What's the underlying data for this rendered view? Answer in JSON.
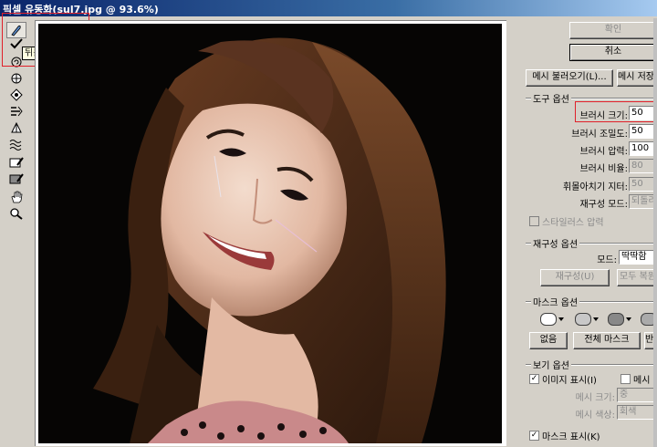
{
  "window": {
    "title": "픽셀 유동화(sul7.jpg @ 93.6%)"
  },
  "toolbox": {
    "tooltip": "뒤틀기 도구(W)",
    "tools": [
      {
        "name": "forward-warp-tool-icon"
      },
      {
        "name": "reconstruct-tool-icon"
      },
      {
        "name": "twirl-tool-icon"
      },
      {
        "name": "pucker-tool-icon"
      },
      {
        "name": "bloat-tool-icon"
      },
      {
        "name": "push-left-tool-icon"
      },
      {
        "name": "mirror-tool-icon"
      },
      {
        "name": "turbulence-tool-icon"
      },
      {
        "name": "freeze-mask-tool-icon"
      },
      {
        "name": "thaw-mask-tool-icon"
      },
      {
        "name": "hand-tool-icon"
      },
      {
        "name": "zoom-tool-icon"
      }
    ]
  },
  "panel": {
    "ok": "확인",
    "cancel": "취소",
    "load_mesh": "메시 불러오기(L)...",
    "save_mesh": "메시 저장",
    "tool_options": {
      "title": "도구 옵션",
      "brush_size": {
        "label": "브러시 크기:",
        "value": "50"
      },
      "brush_density": {
        "label": "브러시 조밀도:",
        "value": "50"
      },
      "brush_pressure": {
        "label": "브러시 압력:",
        "value": "100"
      },
      "brush_rate": {
        "label": "브러시 비율:",
        "value": "80"
      },
      "turbulent_jitter": {
        "label": "휘몰아치기 지터:",
        "value": "50"
      },
      "reconstruct_mode": {
        "label": "재구성 모드:",
        "value": "되돌리기"
      },
      "stylus_pressure": "스타일러스 압력"
    },
    "reconstruct_options": {
      "title": "재구성 옵션",
      "mode_label": "모드:",
      "mode_value": "딱딱함",
      "reconstruct_btn": "재구성(U)",
      "restore_all_btn": "모두 복원"
    },
    "mask_options": {
      "title": "마스크 옵션",
      "none_btn": "없음",
      "mask_all_btn": "전체 마스크",
      "invert_btn": "반전"
    },
    "view_options": {
      "title": "보기 옵션",
      "show_image": "이미지 표시(I)",
      "show_mesh": "메시 표시",
      "mesh_size_label": "메시 크기:",
      "mesh_size_value": "중",
      "mesh_color_label": "메시 색상:",
      "mesh_color_value": "회색",
      "show_mask": "마스크 표시(K)"
    }
  },
  "colors": {
    "highlight": "#e0202a",
    "title_bar": "#0a246a"
  }
}
